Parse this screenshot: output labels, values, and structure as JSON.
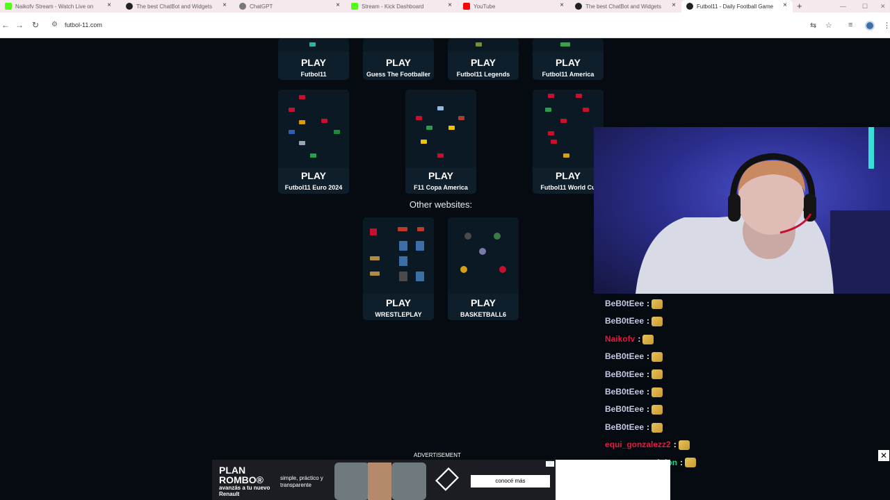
{
  "browser": {
    "tabs": [
      {
        "title": "Naikofv Stream - Watch Live on",
        "icon": "kick-icon",
        "color": "#53fc18"
      },
      {
        "title": "The best ChatBot and Widgets",
        "icon": "github-icon",
        "color": "#222222"
      },
      {
        "title": "ChatGPT",
        "icon": "chatgpt-icon",
        "color": "#555555"
      },
      {
        "title": "Stream - Kick Dashboard",
        "icon": "kick-icon",
        "color": "#53fc18"
      },
      {
        "title": "YouTube",
        "icon": "youtube-icon",
        "color": "#ff0000"
      },
      {
        "title": "The best ChatBot and Widgets",
        "icon": "github-icon",
        "color": "#222222"
      },
      {
        "title": "Futbol11 - Daily Football Game",
        "icon": "futbol11-icon",
        "color": "#222222"
      }
    ],
    "url": "futbol-11.com"
  },
  "games": {
    "play_label": "PLAY",
    "row1": [
      "Futbol11",
      "Guess The Footballer",
      "Futbol11 Legends",
      "Futbol11 America"
    ],
    "row2": [
      "Futbol11 Euro 2024",
      "F11 Copa America",
      "Futbol11 World Cu"
    ]
  },
  "other": {
    "title": "Other websites:",
    "sites": [
      "WRESTLEPLAY",
      "BASKETBALL6"
    ]
  },
  "chat": [
    {
      "user": "BeB0tEee",
      "sep": ":",
      "color": "#c5cae9"
    },
    {
      "user": "BeB0tEee",
      "sep": ":",
      "color": "#c5cae9"
    },
    {
      "user": "Naikofv",
      "sep": ":",
      "color": "#e5194a"
    },
    {
      "user": "BeB0tEee",
      "sep": ":",
      "color": "#c5cae9"
    },
    {
      "user": "BeB0tEee",
      "sep": ":",
      "color": "#c5cae9"
    },
    {
      "user": "BeB0tEee",
      "sep": ":",
      "color": "#c5cae9"
    },
    {
      "user": "BeB0tEee",
      "sep": ":",
      "color": "#c5cae9"
    },
    {
      "user": "BeB0tEee",
      "sep": ":",
      "color": "#c5cae9"
    },
    {
      "user": "equi_gonzalezz2",
      "sep": ":",
      "color": "#e5194a"
    },
    {
      "user": "no_tengo_opinion",
      "sep": ":",
      "color": "#1fd38a"
    }
  ],
  "ad": {
    "label": "ADVERTISEMENT",
    "headline": "PLAN ROMBO®",
    "subline": "avanzás a tu nuevo Renault",
    "tagline": "simple, práctico y transparente",
    "cta": "conocé más"
  }
}
